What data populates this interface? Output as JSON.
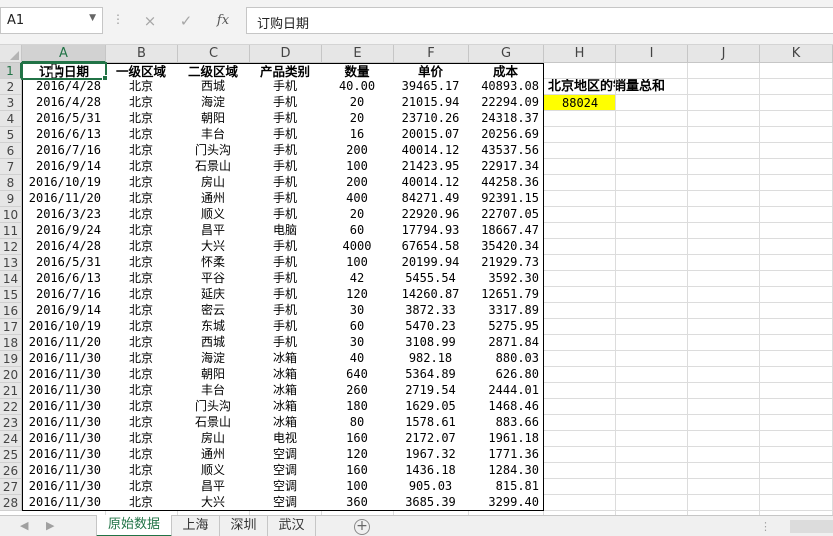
{
  "formula_bar": {
    "name_box": "A1",
    "formula": "订购日期",
    "cancel_icon": "×",
    "enter_icon": "✓",
    "fx_label": "fx"
  },
  "columns": [
    "A",
    "B",
    "C",
    "D",
    "E",
    "F",
    "G",
    "H",
    "I",
    "J",
    "K"
  ],
  "selected_column": "A",
  "row_numbers": [
    "1",
    "2",
    "3",
    "4",
    "5",
    "6",
    "7",
    "8",
    "9",
    "10",
    "11",
    "12",
    "13",
    "14",
    "15",
    "16",
    "17",
    "18",
    "19",
    "20",
    "21",
    "22",
    "23",
    "24",
    "25",
    "26",
    "27",
    "28"
  ],
  "table": {
    "headers": [
      "订购日期",
      "一级区域",
      "二级区域",
      "产品类别",
      "数量",
      "单价",
      "成本"
    ],
    "rows": [
      [
        "2016/4/28",
        "北京",
        "西城",
        "手机",
        "40.00",
        "39465.17",
        "40893.08"
      ],
      [
        "2016/4/28",
        "北京",
        "海淀",
        "手机",
        "20",
        "21015.94",
        "22294.09"
      ],
      [
        "2016/5/31",
        "北京",
        "朝阳",
        "手机",
        "20",
        "23710.26",
        "24318.37"
      ],
      [
        "2016/6/13",
        "北京",
        "丰台",
        "手机",
        "16",
        "20015.07",
        "20256.69"
      ],
      [
        "2016/7/16",
        "北京",
        "门头沟",
        "手机",
        "200",
        "40014.12",
        "43537.56"
      ],
      [
        "2016/9/14",
        "北京",
        "石景山",
        "手机",
        "100",
        "21423.95",
        "22917.34"
      ],
      [
        "2016/10/19",
        "北京",
        "房山",
        "手机",
        "200",
        "40014.12",
        "44258.36"
      ],
      [
        "2016/11/20",
        "北京",
        "通州",
        "手机",
        "400",
        "84271.49",
        "92391.15"
      ],
      [
        "2016/3/23",
        "北京",
        "顺义",
        "手机",
        "20",
        "22920.96",
        "22707.05"
      ],
      [
        "2016/9/24",
        "北京",
        "昌平",
        "电脑",
        "60",
        "17794.93",
        "18667.47"
      ],
      [
        "2016/4/28",
        "北京",
        "大兴",
        "手机",
        "4000",
        "67654.58",
        "35420.34"
      ],
      [
        "2016/5/31",
        "北京",
        "怀柔",
        "手机",
        "100",
        "20199.94",
        "21929.73"
      ],
      [
        "2016/6/13",
        "北京",
        "平谷",
        "手机",
        "42",
        "5455.54",
        "3592.30"
      ],
      [
        "2016/7/16",
        "北京",
        "延庆",
        "手机",
        "120",
        "14260.87",
        "12651.79"
      ],
      [
        "2016/9/14",
        "北京",
        "密云",
        "手机",
        "30",
        "3872.33",
        "3317.89"
      ],
      [
        "2016/10/19",
        "北京",
        "东城",
        "手机",
        "60",
        "5470.23",
        "5275.95"
      ],
      [
        "2016/11/20",
        "北京",
        "西城",
        "手机",
        "30",
        "3108.99",
        "2871.84"
      ],
      [
        "2016/11/30",
        "北京",
        "海淀",
        "冰箱",
        "40",
        "982.18",
        "880.03"
      ],
      [
        "2016/11/30",
        "北京",
        "朝阳",
        "冰箱",
        "640",
        "5364.89",
        "626.80"
      ],
      [
        "2016/11/30",
        "北京",
        "丰台",
        "冰箱",
        "260",
        "2719.54",
        "2444.01"
      ],
      [
        "2016/11/30",
        "北京",
        "门头沟",
        "冰箱",
        "180",
        "1629.05",
        "1468.46"
      ],
      [
        "2016/11/30",
        "北京",
        "石景山",
        "冰箱",
        "80",
        "1578.61",
        "883.66"
      ],
      [
        "2016/11/30",
        "北京",
        "房山",
        "电视",
        "160",
        "2172.07",
        "1961.18"
      ],
      [
        "2016/11/30",
        "北京",
        "通州",
        "空调",
        "120",
        "1967.32",
        "1771.36"
      ],
      [
        "2016/11/30",
        "北京",
        "顺义",
        "空调",
        "160",
        "1436.18",
        "1284.30"
      ],
      [
        "2016/11/30",
        "北京",
        "昌平",
        "空调",
        "100",
        "905.03",
        "815.81"
      ],
      [
        "2016/11/30",
        "北京",
        "大兴",
        "空调",
        "360",
        "3685.39",
        "3299.40"
      ]
    ]
  },
  "side_note": {
    "label": "北京地区的销量总和",
    "value": "88024",
    "highlight_color": "#ffff00"
  },
  "sheet_tabs": [
    "原始数据",
    "上海",
    "深圳",
    "武汉"
  ],
  "active_sheet": "原始数据",
  "accent_color": "#217346"
}
